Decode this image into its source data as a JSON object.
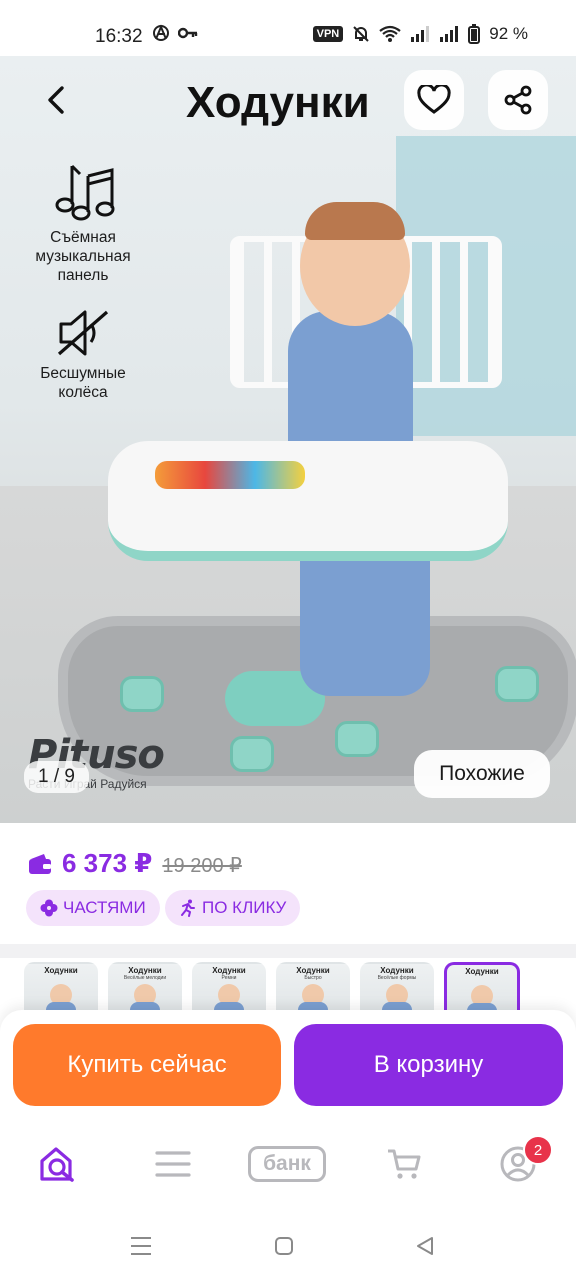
{
  "status_bar": {
    "time": "16:32",
    "vpn": "VPN",
    "battery": "92 %"
  },
  "header": {
    "title": "Ходунки",
    "back_icon": "chevron-left-icon",
    "favorite_icon": "heart-icon",
    "share_icon": "share-icon"
  },
  "gallery": {
    "features": [
      {
        "icon": "music-notes-icon",
        "label": "Съёмная музыкальная панель"
      },
      {
        "icon": "mute-speaker-icon",
        "label": "Бесшумные колёса"
      }
    ],
    "brand": {
      "logo": "Pituso",
      "tagline": "Расти Играй Радуйся"
    },
    "counter": "1 / 9",
    "similar_button": "Похожие"
  },
  "price": {
    "current": "6 373 ₽",
    "old": "19 200 ₽",
    "accent_color": "#8a2be2"
  },
  "chips": [
    {
      "label": "ЧАСТЯМИ",
      "icon": "clover-icon"
    },
    {
      "label": "ПО КЛИКУ",
      "icon": "running-person-icon"
    }
  ],
  "thumbnails": [
    {
      "title": "Ходунки",
      "sub": ""
    },
    {
      "title": "Ходунки",
      "sub": "Весёлые мелодии"
    },
    {
      "title": "Ходунки",
      "sub": "Ремни"
    },
    {
      "title": "Ходунки",
      "sub": "Быстро"
    },
    {
      "title": "Ходунки",
      "sub": "Весёлые формы"
    },
    {
      "title": "Ходунки",
      "sub": ""
    }
  ],
  "actions": {
    "buy_now": "Купить сейчас",
    "add_to_cart": "В корзину",
    "buy_color": "#ff7a2c",
    "cart_color": "#8a2be2"
  },
  "bottom_nav": {
    "bank_label": "банк",
    "profile_badge": "2"
  }
}
